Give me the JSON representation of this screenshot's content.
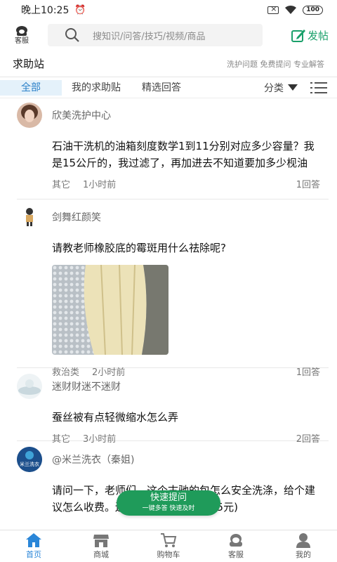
{
  "status_bar": {
    "time": "晚上10:25",
    "battery": "100"
  },
  "header": {
    "kefu_label": "客服",
    "search_placeholder": "搜知识/问答/技巧/视频/商品",
    "post_label": "发帖"
  },
  "section": {
    "title": "求助站",
    "subtitle": "洗护问题 免费提问 专业解答"
  },
  "tabs": [
    {
      "label": "全部",
      "active": true
    },
    {
      "label": "我的求助贴"
    },
    {
      "label": "精选回答"
    }
  ],
  "filter_label": "分类",
  "posts": [
    {
      "user": "欣美洗护中心",
      "question": "石油干洗机的油箱刻度数学1到11分别对应多少容量？我是15公斤的，我过滤了，再加进去不知道要加多少枧油",
      "category": "其它",
      "time": "1小时前",
      "answers": "1回答"
    },
    {
      "user": "剑舞红颜笑",
      "question": "请教老师橡胶底的霉斑用什么祛除呢?",
      "category": "救治类",
      "time": "2小时前",
      "answers": "1回答",
      "has_photo": true
    },
    {
      "user": "迷财财迷不迷财",
      "question": "蚕丝被有点轻微缩水怎么弄",
      "category": "其它",
      "time": "3小时前",
      "answers": "2回答"
    },
    {
      "user": "@米兰洗衣（秦姐)",
      "avatar_text": "米兰洗衣",
      "question": "请问一下，老师们，这个古驰的包怎么安全洗涤，给个建议怎么收费。还有个款羽绒服收费25元)"
    }
  ],
  "fab": {
    "title": "快速提问",
    "subtitle": "一键多答 快速及时"
  },
  "bottom_nav": [
    {
      "label": "首页",
      "icon": "home-icon",
      "active": true
    },
    {
      "label": "商城",
      "icon": "shop-icon"
    },
    {
      "label": "购物车",
      "icon": "cart-icon"
    },
    {
      "label": "客服",
      "icon": "headset-icon"
    },
    {
      "label": "我的",
      "icon": "user-icon"
    }
  ],
  "colors": {
    "brand_green": "#1aa06a",
    "fab_green": "#1f9b5a",
    "active_blue": "#2a86d8",
    "tab_bg": "#e4f1fa"
  }
}
